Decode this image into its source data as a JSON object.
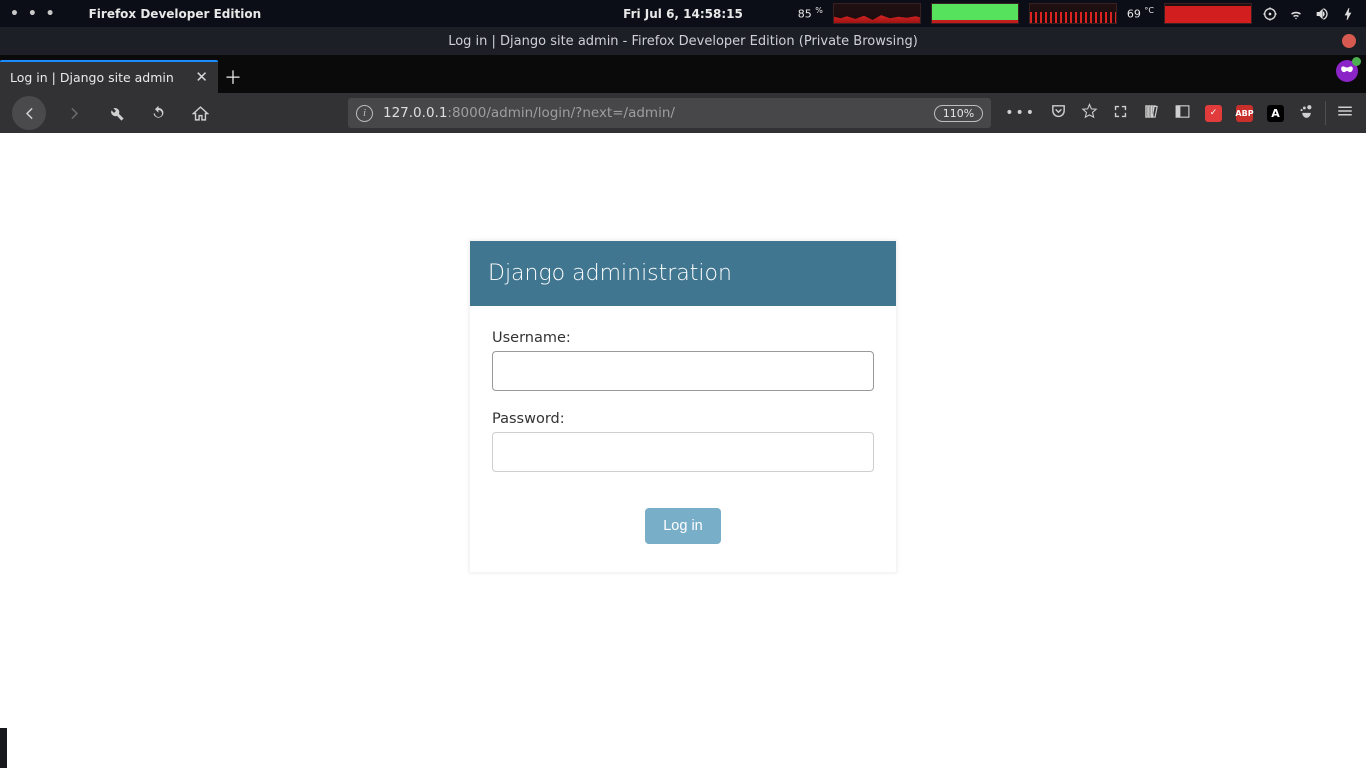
{
  "system_bar": {
    "active_app": "Firefox Developer Edition",
    "clock": "Fri Jul  6, 14:58:15",
    "battery_pct": "85",
    "battery_unit": "%",
    "temp_value": "69",
    "temp_unit": "°C"
  },
  "window": {
    "title": "Log in | Django site admin - Firefox Developer Edition (Private Browsing)"
  },
  "tab": {
    "label": "Log in | Django site admin"
  },
  "url": {
    "host": "127.0.0.1",
    "port_path": ":8000/admin/login/?next=/admin/",
    "zoom": "110%"
  },
  "django": {
    "header": "Django administration",
    "username_label": "Username:",
    "password_label": "Password:",
    "login_button": "Log in"
  }
}
